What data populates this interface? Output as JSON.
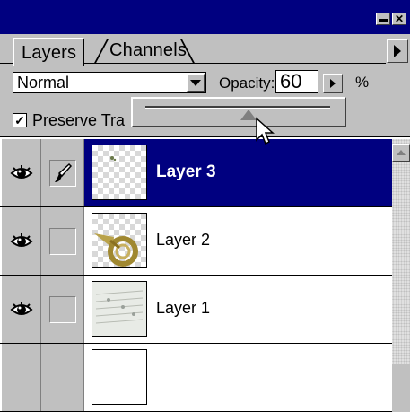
{
  "window": {
    "close_glyph": "✕",
    "minimize_glyph": ""
  },
  "tabs": [
    {
      "label": "Layers",
      "active": true
    },
    {
      "label": "Channels",
      "active": false
    }
  ],
  "options": {
    "blend_mode": "Normal",
    "opacity_label": "Opacity:",
    "opacity_value": "60",
    "percent": "%"
  },
  "preserve": {
    "checked": true,
    "check_glyph": "✓",
    "label": "Preserve Tra"
  },
  "layers": [
    {
      "name": "Layer 3",
      "selected": true,
      "visible": true,
      "brush": true
    },
    {
      "name": "Layer 2",
      "selected": false,
      "visible": true,
      "brush": false
    },
    {
      "name": "Layer 1",
      "selected": false,
      "visible": true,
      "brush": false
    }
  ],
  "colors": {
    "selection": "#000080",
    "panel": "#c0c0c0"
  }
}
